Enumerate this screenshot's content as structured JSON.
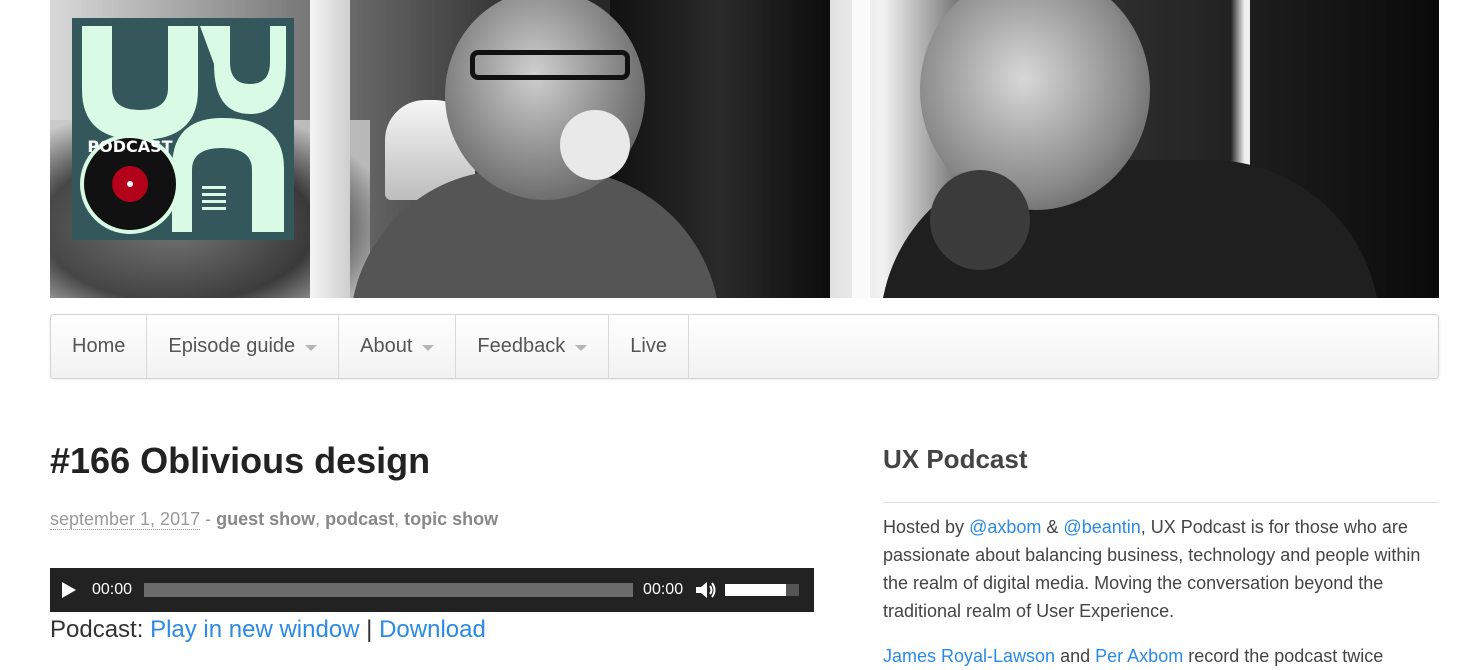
{
  "header": {
    "logo_alt": "UX Podcast logo",
    "logo_letters": "UX",
    "logo_badge_text": "PODCAST"
  },
  "nav": {
    "items": [
      {
        "label": "Home",
        "dropdown": false
      },
      {
        "label": "Episode guide",
        "dropdown": true
      },
      {
        "label": "About",
        "dropdown": true
      },
      {
        "label": "Feedback",
        "dropdown": true
      },
      {
        "label": "Live",
        "dropdown": false
      }
    ]
  },
  "post": {
    "title": "#166 Oblivious design",
    "date": "september 1, 2017",
    "meta_separator": " - ",
    "tags": [
      "guest show",
      "podcast",
      "topic show"
    ],
    "player": {
      "current_time": "00:00",
      "duration": "00:00",
      "volume": 0.82
    },
    "podcast_label": "Podcast:",
    "play_new_window": "Play in new window",
    "link_separator": "|",
    "download": "Download"
  },
  "sidebar": {
    "title": "UX Podcast",
    "hosted_by": "Hosted by",
    "host1": "@axbom",
    "amp": "&",
    "host2": "@beantin",
    "description": ", UX Podcast is for those who are passionate about balancing business, technology and people within the realm of digital media. Moving the conversation beyond the traditional realm of User Experience.",
    "p2_name1": "James Royal-Lawson",
    "p2_and": "and",
    "p2_name2": "Per Axbom",
    "p2_rest": "record the podcast twice"
  },
  "colors": {
    "link": "#2a8ae5",
    "logo_bg": "#33575a",
    "logo_fg": "#d9fbe6",
    "player_bg": "#222222"
  }
}
